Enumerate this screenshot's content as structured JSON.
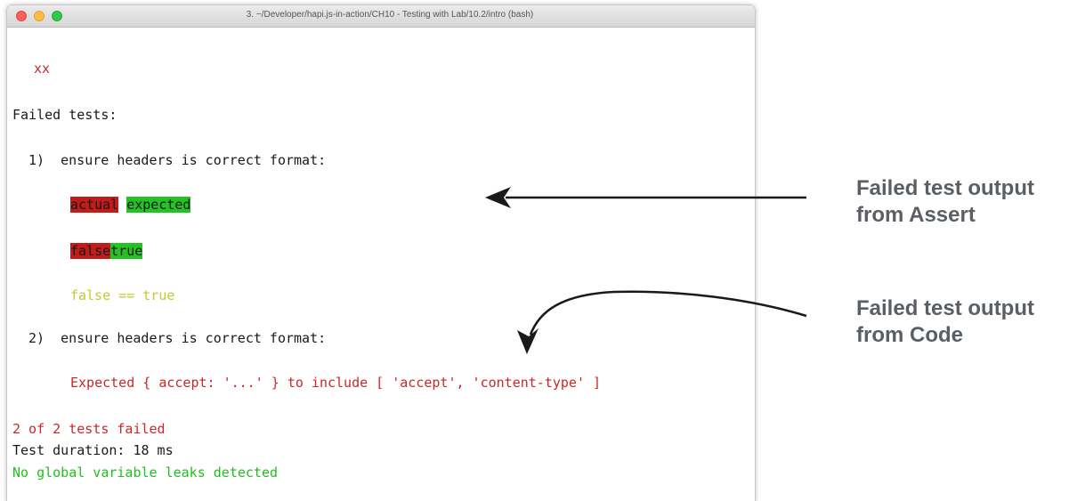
{
  "window": {
    "title": "3. ~/Developer/hapi.js-in-action/CH10 - Testing with Lab/10.2/intro (bash)"
  },
  "terminal": {
    "marks": "xx",
    "failed_header": "Failed tests:",
    "test1": {
      "label": "1)  ensure headers is correct format:",
      "actual_word": "actual",
      "expected_word": "expected",
      "false_word": "false",
      "true_word": "true",
      "comparison": "false == true"
    },
    "test2": {
      "label": "2)  ensure headers is correct format:",
      "message": "Expected { accept: '...' } to include [ 'accept', 'content-type' ]"
    },
    "summary_failed": "2 of 2 tests failed",
    "duration": "Test duration: 18 ms",
    "leaks": "No global variable leaks detected"
  },
  "annotations": {
    "assert_line1": "Failed test output",
    "assert_line2": "from Assert",
    "code_line1": "Failed test output",
    "code_line2": "from Code"
  },
  "colors": {
    "error_red": "#c82828",
    "diff_red_bg": "#c01c1c",
    "diff_green_bg": "#22c322",
    "success_green": "#1fbf1f",
    "assert_yellow": "#c8c832",
    "annotation_gray": "#5a5f66"
  }
}
